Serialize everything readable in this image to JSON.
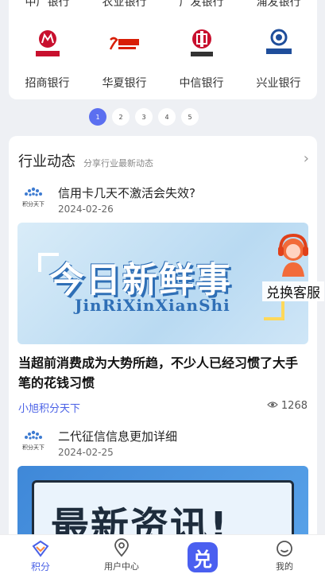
{
  "bank_grid": {
    "top_row": [
      "中广银行",
      "农业银行",
      "广发银行",
      "浦发银行"
    ],
    "banks": [
      {
        "name": "招商银行",
        "logo_text": "招商银行",
        "color": "#c8102e"
      },
      {
        "name": "华夏银行",
        "logo_text": "华夏银行",
        "color": "#d81e06"
      },
      {
        "name": "中信银行",
        "logo_text": "中信银行",
        "color": "#c8102e"
      },
      {
        "name": "兴业银行",
        "logo_text": "兴业银行",
        "color": "#1f4e9b"
      }
    ]
  },
  "pager": {
    "pages": [
      "1",
      "2",
      "3",
      "4",
      "5"
    ],
    "active": 0
  },
  "section": {
    "title": "行业动态",
    "subtitle": "分享行业最新动态",
    "arrow": "›"
  },
  "news": [
    {
      "logo_text": "积分天下",
      "title": "信用卡几天不激活会失效?",
      "date": "2024-02-26",
      "banner_title": "今日新鲜事",
      "banner_pinyin": "JinRiXinXianShi",
      "headline": "当超前消费成为大势所趋，不少人已经习惯了大手笔的花钱习惯",
      "source": "小旭积分天下",
      "views": "1268"
    },
    {
      "logo_text": "积分天下",
      "title": "二代征信信息更加详细",
      "date": "2024-02-25",
      "banner_title": "最新资讯!"
    }
  ],
  "service": {
    "label": "兑换客服"
  },
  "tabbar": {
    "items": [
      {
        "label": "积分",
        "icon": "points-icon",
        "active": true
      },
      {
        "label": "用户中心",
        "icon": "location-icon",
        "active": false
      },
      {
        "label": "兑",
        "icon": "exchange-icon",
        "active": false
      },
      {
        "label": "我的",
        "icon": "profile-icon",
        "active": false
      }
    ]
  },
  "colors": {
    "accent": "#4a61e6",
    "background": "#eef0f4"
  }
}
